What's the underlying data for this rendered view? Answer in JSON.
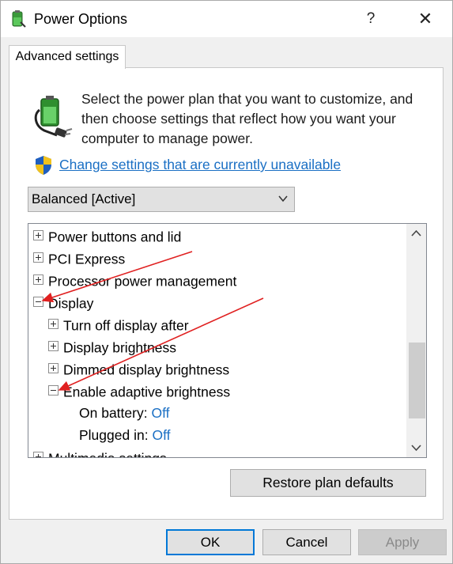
{
  "window": {
    "title": "Power Options",
    "help_glyph": "?",
    "close_glyph": "✕"
  },
  "tab": {
    "label": "Advanced settings"
  },
  "description": "Select the power plan that you want to customize, and then choose settings that reflect how you want your computer to manage power.",
  "change_link": "Change settings that are currently unavailable",
  "plan_dropdown": {
    "value": "Balanced [Active]"
  },
  "tree": {
    "items": [
      {
        "label": "Power buttons and lid",
        "state": "collapsed"
      },
      {
        "label": "PCI Express",
        "state": "collapsed"
      },
      {
        "label": "Processor power management",
        "state": "collapsed"
      },
      {
        "label": "Display",
        "state": "expanded"
      },
      {
        "label": "Turn off display after",
        "state": "collapsed"
      },
      {
        "label": "Display brightness",
        "state": "collapsed"
      },
      {
        "label": "Dimmed display brightness",
        "state": "collapsed"
      },
      {
        "label": "Enable adaptive brightness",
        "state": "expanded"
      },
      {
        "label": "Multimedia settings",
        "state": "collapsed"
      }
    ],
    "on_battery": {
      "label": "On battery:",
      "value": "Off"
    },
    "plugged_in": {
      "label": "Plugged in:",
      "value": "Off"
    }
  },
  "buttons": {
    "restore": "Restore plan defaults",
    "ok": "OK",
    "cancel": "Cancel",
    "apply": "Apply"
  },
  "colors": {
    "link": "#1a6fc4",
    "annotation_arrow": "#e02020",
    "ok_focus": "#0078d7"
  }
}
